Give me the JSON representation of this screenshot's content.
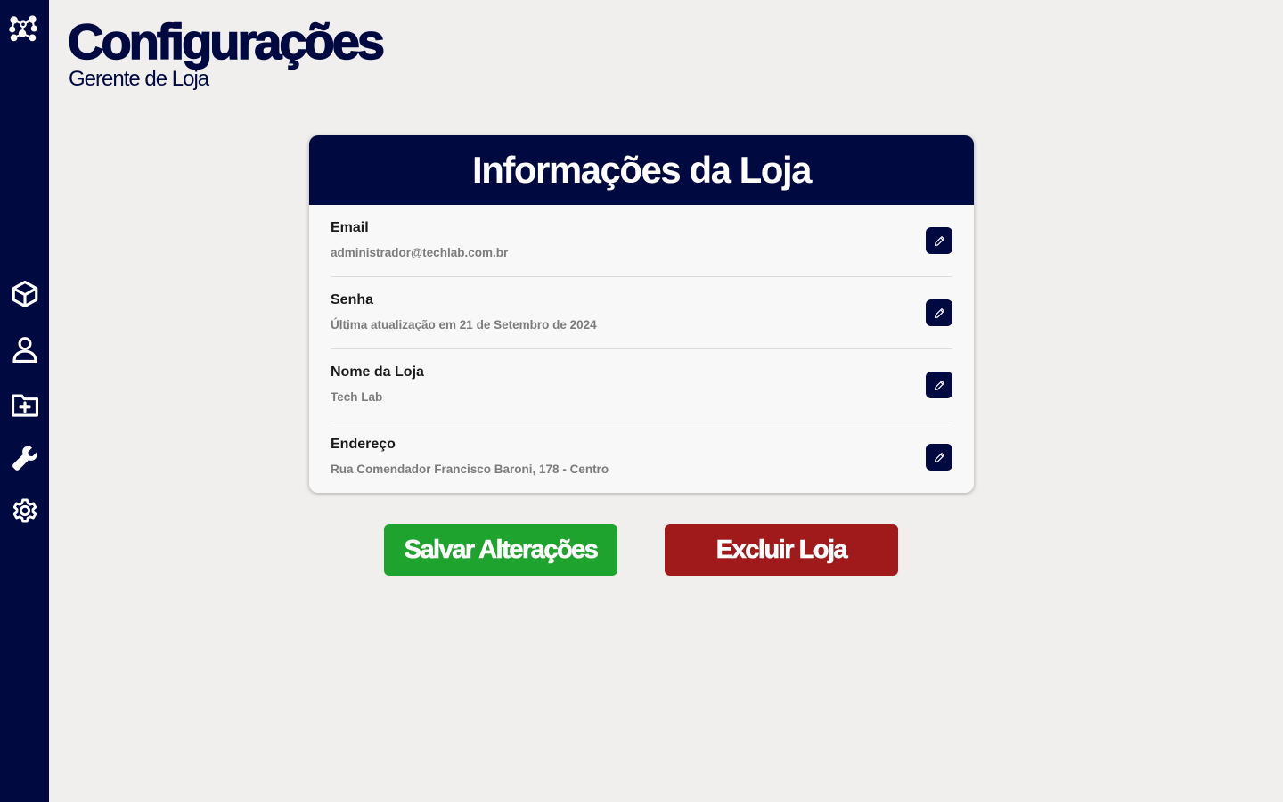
{
  "header": {
    "title": "Configurações",
    "subtitle": "Gerente de Loja"
  },
  "sidebar": {
    "logo_icon": "molecule-logo-icon",
    "items": [
      {
        "icon": "cube-icon"
      },
      {
        "icon": "user-icon"
      },
      {
        "icon": "folder-plus-icon"
      },
      {
        "icon": "wrench-icon"
      },
      {
        "icon": "gear-icon"
      }
    ]
  },
  "card": {
    "title": "Informações da Loja",
    "rows": [
      {
        "label": "Email",
        "value": "administrador@techlab.com.br",
        "action_icon": "pencil-icon"
      },
      {
        "label": "Senha",
        "value": "Última atualização em 21 de Setembro de 2024",
        "action_icon": "pencil-icon"
      },
      {
        "label": "Nome da Loja",
        "value": "Tech Lab",
        "action_icon": "pencil-icon"
      },
      {
        "label": "Endereço",
        "value": "Rua Comendador Francisco Baroni, 178 - Centro",
        "action_icon": "pencil-icon"
      }
    ]
  },
  "actions": {
    "save_label": "Salvar Alterações",
    "delete_label": "Excluir Loja"
  },
  "colors": {
    "navy": "#000940",
    "background": "#f0efed",
    "save": "#1fa32f",
    "delete": "#a0191b"
  }
}
